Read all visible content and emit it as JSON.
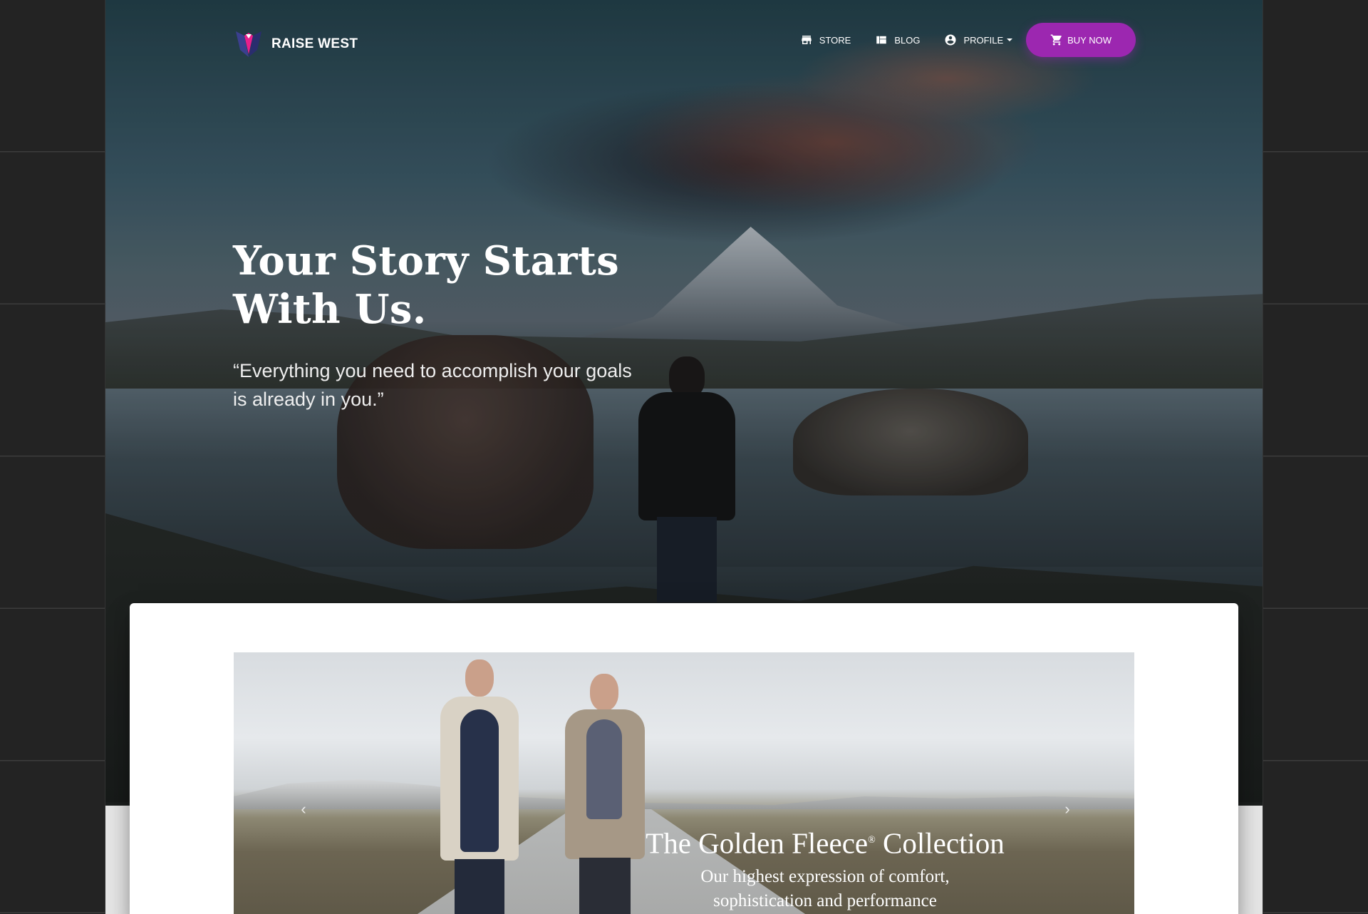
{
  "brand": {
    "name": "RAISE WEST",
    "accent": "#9c27b0"
  },
  "nav": {
    "items": [
      {
        "label": "STORE",
        "icon": "store-icon"
      },
      {
        "label": "BLOG",
        "icon": "dashboard-icon"
      },
      {
        "label": "PROFILE",
        "icon": "account-circle-icon",
        "dropdown": true
      }
    ],
    "buy_label": "BUY NOW",
    "buy_icon": "cart-icon"
  },
  "hero": {
    "title_line1": "Your Story Starts",
    "title_line2": "With Us.",
    "quote_line1": "“Everything you need to accomplish your goals",
    "quote_line2": "is already in you.”"
  },
  "carousel": {
    "caption_title": "The Golden Fleece",
    "caption_mark": "®",
    "caption_title_end": " Collection",
    "caption_sub_line1": "Our highest expression of comfort,",
    "caption_sub_line2": "sophistication and performance"
  }
}
